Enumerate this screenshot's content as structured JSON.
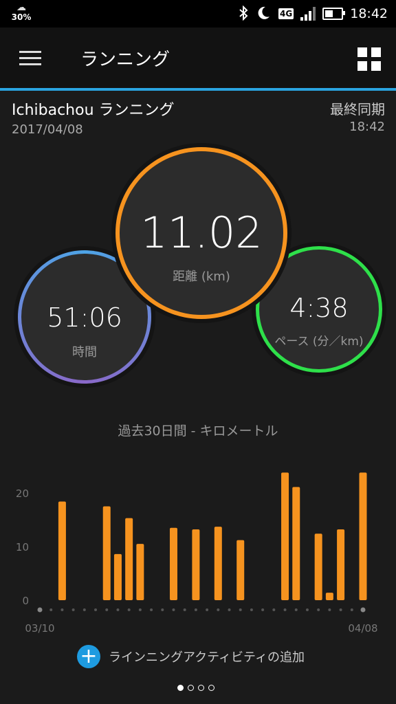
{
  "status_bar": {
    "weather_percent": "30%",
    "network_type": "4G",
    "signal_level": 0.75,
    "battery_level": 0.5,
    "time": "18:42",
    "icons": [
      "bluetooth-icon",
      "moon-icon",
      "signal-icon",
      "battery-icon"
    ]
  },
  "app_bar": {
    "title": "ランニング",
    "menu_icon": "hamburger-icon",
    "grid_icon": "grid-icon",
    "accent_color": "#2aa4e0"
  },
  "activity": {
    "name": "Ichibachou ランニング",
    "date": "2017/04/08",
    "sync_label": "最終同期",
    "sync_time": "18:42"
  },
  "stats": {
    "distance": {
      "value": "11.02",
      "label": "距離 (km)",
      "color": "#f6931f"
    },
    "time": {
      "value": "51:06",
      "label": "時間",
      "colors": [
        "#4ea4e6",
        "#8a68c8"
      ]
    },
    "pace": {
      "value": "4:38",
      "label": "ペース (分／km)",
      "color": "#2ee04a"
    }
  },
  "chart_title": "過去30日間 - キロメートル",
  "chart_data": {
    "type": "bar",
    "title": "過去30日間 - キロメートル",
    "x_start_label": "03/10",
    "x_end_label": "04/08",
    "y_ticks": [
      0,
      10,
      20
    ],
    "ylim": [
      0,
      25
    ],
    "bar_color": "#f6931f",
    "values": [
      0,
      0,
      18.4,
      0,
      0,
      0,
      17.5,
      8.6,
      15.3,
      10.5,
      0,
      0,
      13.5,
      0,
      13.2,
      0,
      13.7,
      0,
      11.2,
      0,
      0,
      0,
      23.8,
      21.1,
      0,
      12.4,
      1.4,
      13.2,
      0,
      23.8
    ]
  },
  "add_activity": {
    "label": "ラインニングアクティビティの追加",
    "icon": "plus-icon",
    "color": "#1e9be0"
  },
  "page_indicator": {
    "count": 4,
    "active": 0
  }
}
